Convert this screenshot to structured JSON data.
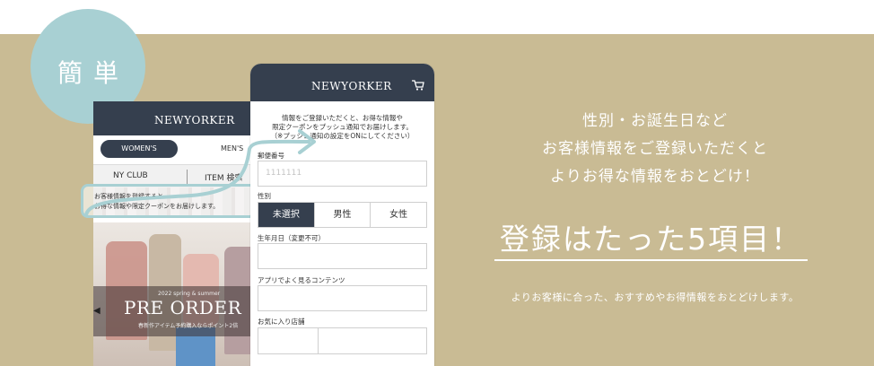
{
  "badge": {
    "text": "簡単"
  },
  "back_phone": {
    "logo": "NEWYORKER",
    "tab_women": "WOMEN'S",
    "tab_men": "MEN'S",
    "menu_left": "NY CLUB",
    "menu_right": "ITEM 検索",
    "notice_line1": "お客様情報を登録すると",
    "notice_line2": "お得な情報や限定クーポンをお届けします。",
    "banner_small": "2022 spring & summer",
    "banner_title": "PRE ORDER",
    "banner_sub": "春新作アイテム予約購入ならポイント2倍"
  },
  "front_phone": {
    "logo": "NEWYORKER",
    "intro_line1": "情報をご登録いただくと、お得な情報や",
    "intro_line2": "限定クーポンをプッシュ通知でお届けします。",
    "intro_line3": "（※プッシュ通知の設定をONにしてください）",
    "postal_label": "郵便番号",
    "postal_placeholder": "1111111",
    "gender_label": "性別",
    "gender_options": [
      "未選択",
      "男性",
      "女性"
    ],
    "gender_selected": "未選択",
    "birthday_label": "生年月日（変更不可）",
    "content_label": "アプリでよく見るコンテンツ",
    "store_label": "お気に入り店舗"
  },
  "copy": {
    "line1": "性別・お誕生日など",
    "line2": "お客様情報をご登録いただくと",
    "line3": "よりお得な情報をおとどけ！",
    "headline": "登録はたった5項目！",
    "footnote": "よりお客様に合った、おすすめやお得情報をおとどけします。"
  },
  "colors": {
    "band": "#c9bb94",
    "badge": "#a8d0d3",
    "navy": "#353f4e",
    "accent_arrow": "#a8d0d3"
  },
  "icons": [
    "cart-icon",
    "arrow-connector-icon",
    "left-chevron-icon"
  ]
}
